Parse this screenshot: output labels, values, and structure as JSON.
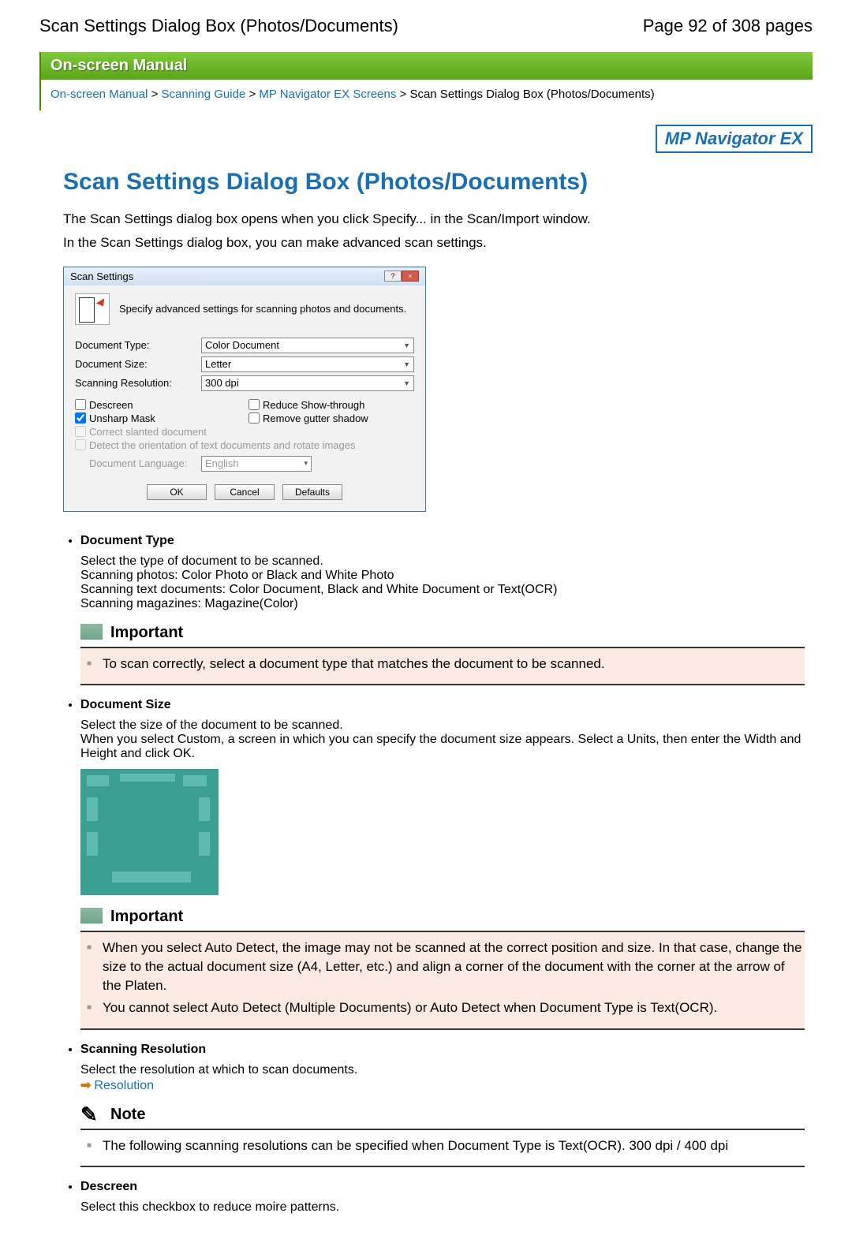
{
  "header": {
    "title": "Scan Settings Dialog Box (Photos/Documents)",
    "page_info": "Page 92 of 308 pages"
  },
  "banner": "On-screen Manual",
  "breadcrumb": {
    "items": [
      "On-screen Manual",
      "Scanning Guide",
      "MP Navigator EX Screens"
    ],
    "current": "Scan Settings Dialog Box (Photos/Documents)"
  },
  "mp_badge": "MP Navigator EX",
  "h1": "Scan Settings Dialog Box (Photos/Documents)",
  "intro1": "The Scan Settings dialog box opens when you click Specify... in the Scan/Import window.",
  "intro2": "In the Scan Settings dialog box, you can make advanced scan settings.",
  "dialog": {
    "title": "Scan Settings",
    "caption": "Specify advanced settings for scanning photos and documents.",
    "fields": {
      "doctype_lbl": "Document Type:",
      "doctype_val": "Color Document",
      "docsize_lbl": "Document Size:",
      "docsize_val": "Letter",
      "res_lbl": "Scanning Resolution:",
      "res_val": "300 dpi",
      "lang_lbl": "Document Language:",
      "lang_val": "English"
    },
    "checks": {
      "descreen": "Descreen",
      "reduce": "Reduce Show-through",
      "unsharp": "Unsharp Mask",
      "gutter": "Remove gutter shadow",
      "slanted": "Correct slanted document",
      "orient": "Detect the orientation of text documents and rotate images"
    },
    "buttons": {
      "ok": "OK",
      "cancel": "Cancel",
      "defaults": "Defaults"
    }
  },
  "sections": {
    "doctype": {
      "title": "Document Type",
      "l1": "Select the type of document to be scanned.",
      "l2": "Scanning photos: Color Photo or Black and White Photo",
      "l3": "Scanning text documents: Color Document, Black and White Document or Text(OCR)",
      "l4": "Scanning magazines: Magazine(Color)"
    },
    "doctype_important": {
      "title": "Important",
      "item1": "To scan correctly, select a document type that matches the document to be scanned."
    },
    "docsize": {
      "title": "Document Size",
      "l1": "Select the size of the document to be scanned.",
      "l2": "When you select Custom, a screen in which you can specify the document size appears. Select a Units, then enter the Width and Height and click OK."
    },
    "docsize_important": {
      "title": "Important",
      "item1": "When you select Auto Detect, the image may not be scanned at the correct position and size. In that case, change the size to the actual document size (A4, Letter, etc.) and align a corner of the document with the corner at the arrow of the Platen.",
      "item2": "You cannot select Auto Detect (Multiple Documents) or Auto Detect when Document Type is Text(OCR)."
    },
    "resolution": {
      "title": "Scanning Resolution",
      "l1": "Select the resolution at which to scan documents.",
      "link": "Resolution"
    },
    "res_note": {
      "title": "Note",
      "item1": "The following scanning resolutions can be specified when Document Type is Text(OCR). 300 dpi / 400 dpi"
    },
    "descreen": {
      "title": "Descreen",
      "l1": "Select this checkbox to reduce moire patterns."
    }
  }
}
